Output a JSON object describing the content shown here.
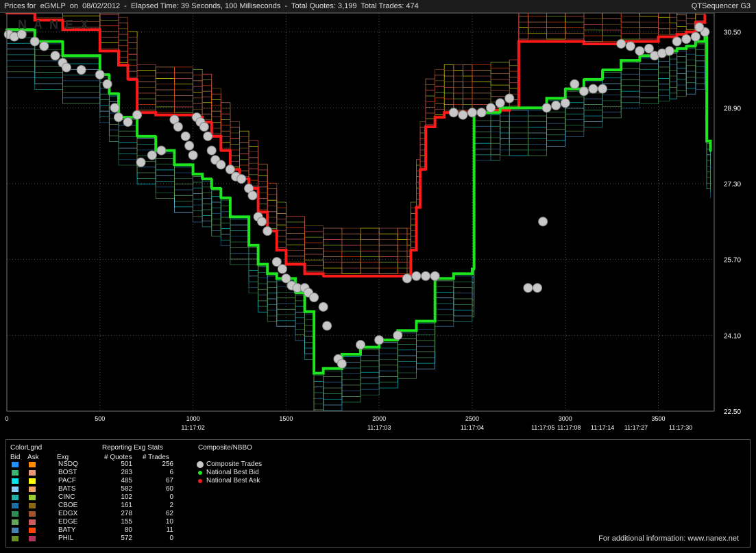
{
  "header": {
    "left": "Prices for  eGMLP  on  08/02/2012  -  Elapsed Time: 39 Seconds, 100 Milliseconds  -  Total Quotes: 3,199  Total Trades: 474",
    "right": "QTSequencer G3"
  },
  "watermark": "NANEX",
  "chart_data": {
    "type": "line",
    "title": "",
    "xlim": [
      0,
      3800
    ],
    "ylim": [
      22.5,
      30.9
    ],
    "yticks": [
      "30.50",
      "28.90",
      "27.30",
      "25.70",
      "24.10",
      "22.50"
    ],
    "ytick_values": [
      30.5,
      28.9,
      27.3,
      25.7,
      24.1,
      22.5
    ],
    "xticks": [
      "0",
      "500",
      "1000",
      "1500",
      "2000",
      "2500",
      "3000",
      "3500"
    ],
    "xtick_values": [
      0,
      500,
      1000,
      1500,
      2000,
      2500,
      3000,
      3500
    ],
    "time_labels": [
      {
        "x": 1000,
        "label": "11:17:02"
      },
      {
        "x": 2000,
        "label": "11:17:03"
      },
      {
        "x": 2500,
        "label": "11:17:04"
      },
      {
        "x": 2880,
        "label": "11:17:05"
      },
      {
        "x": 3020,
        "label": "11:17:08"
      },
      {
        "x": 3200,
        "label": "11:17:14"
      },
      {
        "x": 3380,
        "label": "11:17:27"
      },
      {
        "x": 3620,
        "label": "11:17:30"
      }
    ],
    "series": [
      {
        "name": "National Best Ask",
        "color": "#ff1a1a",
        "x": [
          0,
          150,
          300,
          500,
          600,
          650,
          700,
          800,
          900,
          1000,
          1050,
          1100,
          1150,
          1200,
          1250,
          1300,
          1350,
          1400,
          1450,
          1500,
          1600,
          1700,
          1800,
          1900,
          2000,
          2100,
          2150,
          2170,
          2200,
          2220,
          2250,
          2300,
          2350,
          2400,
          2450,
          2500,
          2600,
          2700,
          2750,
          2800,
          2900,
          3000,
          3100,
          3200,
          3300,
          3400,
          3500,
          3560,
          3600,
          3650,
          3700,
          3750
        ],
        "y": [
          30.9,
          30.75,
          30.55,
          30.1,
          29.8,
          29.5,
          28.8,
          28.75,
          28.75,
          28.7,
          28.6,
          28.3,
          28.0,
          27.6,
          27.4,
          27.2,
          26.7,
          26.3,
          25.9,
          25.6,
          25.4,
          25.35,
          25.35,
          25.35,
          25.35,
          25.35,
          25.35,
          25.9,
          26.8,
          27.6,
          28.5,
          28.7,
          28.8,
          28.8,
          28.8,
          28.8,
          28.85,
          28.9,
          30.3,
          30.3,
          30.3,
          30.3,
          30.25,
          30.25,
          30.3,
          30.3,
          30.4,
          30.4,
          30.45,
          30.5,
          30.7,
          30.85
        ]
      },
      {
        "name": "National Best Bid",
        "color": "#1ee61e",
        "x": [
          0,
          150,
          300,
          500,
          550,
          600,
          700,
          800,
          900,
          1000,
          1050,
          1100,
          1150,
          1200,
          1300,
          1350,
          1400,
          1450,
          1550,
          1600,
          1650,
          1700,
          1800,
          1900,
          2000,
          2100,
          2200,
          2300,
          2400,
          2500,
          2510,
          2600,
          2650,
          2700,
          2800,
          2900,
          3000,
          3100,
          3200,
          3300,
          3400,
          3500,
          3560,
          3600,
          3650,
          3700,
          3750,
          3760,
          3780
        ],
        "y": [
          30.55,
          30.3,
          30.0,
          29.6,
          29.2,
          28.7,
          28.3,
          28.0,
          27.7,
          27.5,
          27.4,
          27.2,
          27.0,
          26.6,
          26.0,
          25.6,
          25.4,
          25.3,
          25.0,
          24.6,
          23.3,
          23.4,
          23.7,
          23.85,
          24.0,
          24.2,
          24.4,
          25.3,
          25.4,
          25.5,
          28.8,
          28.8,
          28.9,
          28.9,
          28.9,
          29.1,
          29.3,
          29.5,
          29.7,
          29.9,
          30.0,
          30.05,
          30.1,
          30.15,
          30.2,
          30.3,
          30.4,
          28.2,
          28.0
        ]
      }
    ],
    "trades": [
      [
        10,
        30.45
      ],
      [
        40,
        30.4
      ],
      [
        80,
        30.45
      ],
      [
        150,
        30.3
      ],
      [
        200,
        30.2
      ],
      [
        260,
        30.0
      ],
      [
        300,
        29.85
      ],
      [
        320,
        29.75
      ],
      [
        400,
        29.7
      ],
      [
        500,
        29.6
      ],
      [
        540,
        29.4
      ],
      [
        580,
        28.9
      ],
      [
        600,
        28.7
      ],
      [
        650,
        28.6
      ],
      [
        700,
        28.75
      ],
      [
        720,
        27.75
      ],
      [
        780,
        27.9
      ],
      [
        830,
        28.0
      ],
      [
        900,
        28.65
      ],
      [
        920,
        28.5
      ],
      [
        960,
        28.3
      ],
      [
        980,
        28.1
      ],
      [
        1000,
        27.9
      ],
      [
        1020,
        28.7
      ],
      [
        1040,
        28.6
      ],
      [
        1060,
        28.5
      ],
      [
        1080,
        28.3
      ],
      [
        1100,
        28.0
      ],
      [
        1120,
        27.8
      ],
      [
        1150,
        27.7
      ],
      [
        1200,
        27.6
      ],
      [
        1230,
        27.45
      ],
      [
        1260,
        27.4
      ],
      [
        1300,
        27.2
      ],
      [
        1320,
        27.05
      ],
      [
        1350,
        26.6
      ],
      [
        1370,
        26.5
      ],
      [
        1400,
        26.3
      ],
      [
        1450,
        25.65
      ],
      [
        1480,
        25.5
      ],
      [
        1500,
        25.3
      ],
      [
        1530,
        25.15
      ],
      [
        1560,
        25.1
      ],
      [
        1600,
        25.1
      ],
      [
        1620,
        25.0
      ],
      [
        1650,
        24.9
      ],
      [
        1700,
        24.7
      ],
      [
        1720,
        24.3
      ],
      [
        1780,
        23.6
      ],
      [
        1800,
        23.5
      ],
      [
        1900,
        23.9
      ],
      [
        2000,
        24.0
      ],
      [
        2100,
        24.1
      ],
      [
        2150,
        25.3
      ],
      [
        2200,
        25.35
      ],
      [
        2250,
        25.35
      ],
      [
        2300,
        25.35
      ],
      [
        2400,
        28.8
      ],
      [
        2450,
        28.75
      ],
      [
        2500,
        28.8
      ],
      [
        2550,
        28.8
      ],
      [
        2600,
        28.9
      ],
      [
        2650,
        29.0
      ],
      [
        2700,
        29.1
      ],
      [
        2800,
        25.1
      ],
      [
        2850,
        25.1
      ],
      [
        2900,
        28.9
      ],
      [
        2950,
        28.95
      ],
      [
        3000,
        29.0
      ],
      [
        3050,
        29.4
      ],
      [
        3100,
        29.25
      ],
      [
        3150,
        29.3
      ],
      [
        3200,
        29.3
      ],
      [
        3300,
        30.25
      ],
      [
        3350,
        30.2
      ],
      [
        3400,
        30.1
      ],
      [
        3450,
        30.15
      ],
      [
        3480,
        30.0
      ],
      [
        3520,
        30.05
      ],
      [
        3560,
        30.1
      ],
      [
        3600,
        30.3
      ],
      [
        3650,
        30.35
      ],
      [
        3700,
        30.4
      ],
      [
        3750,
        30.5
      ],
      [
        2880,
        26.5
      ],
      [
        3720,
        30.6
      ]
    ]
  },
  "legend": {
    "title_colorlgnd": "ColorLgnd",
    "title_stats": "Reporting Exg Stats",
    "title_nbbo": "Composite/NBBO",
    "h_bid": "Bid",
    "h_ask": "Ask",
    "h_exg": "Exg",
    "h_quotes": "# Quotes",
    "h_trades": "# Trades",
    "rows": [
      {
        "exg": "NSDQ",
        "quotes": "501",
        "trades": "256",
        "bid_color": "#1e90ff",
        "ask_color": "#ff8c00"
      },
      {
        "exg": "BOST",
        "quotes": "283",
        "trades": "6",
        "bid_color": "#3cb371",
        "ask_color": "#e9967a"
      },
      {
        "exg": "PACF",
        "quotes": "485",
        "trades": "67",
        "bid_color": "#00e5ee",
        "ask_color": "#ffff00"
      },
      {
        "exg": "BATS",
        "quotes": "582",
        "trades": "60",
        "bid_color": "#87cefa",
        "ask_color": "#f4a460"
      },
      {
        "exg": "CINC",
        "quotes": "102",
        "trades": "0",
        "bid_color": "#20b2aa",
        "ask_color": "#9acd32"
      },
      {
        "exg": "CBOE",
        "quotes": "161",
        "trades": "2",
        "bid_color": "#1c6ea4",
        "ask_color": "#8b6914"
      },
      {
        "exg": "EDGX",
        "quotes": "278",
        "trades": "62",
        "bid_color": "#2e8b57",
        "ask_color": "#a0522d"
      },
      {
        "exg": "EDGE",
        "quotes": "155",
        "trades": "10",
        "bid_color": "#66a65a",
        "ask_color": "#cd5c5c"
      },
      {
        "exg": "BATY",
        "quotes": "80",
        "trades": "11",
        "bid_color": "#4682b4",
        "ask_color": "#ff4500"
      },
      {
        "exg": "PHIL",
        "quotes": "572",
        "trades": "0",
        "bid_color": "#6b8e23",
        "ask_color": "#b03060"
      }
    ],
    "nbbo": [
      {
        "label": "Composite Trades",
        "color": "#c8c8c8",
        "kind": "big"
      },
      {
        "label": "National Best Bid",
        "color": "#1ee61e",
        "kind": "small"
      },
      {
        "label": "National Best Ask",
        "color": "#ff1a1a",
        "kind": "small"
      }
    ]
  },
  "footer": "For additional information: www.nanex.net"
}
